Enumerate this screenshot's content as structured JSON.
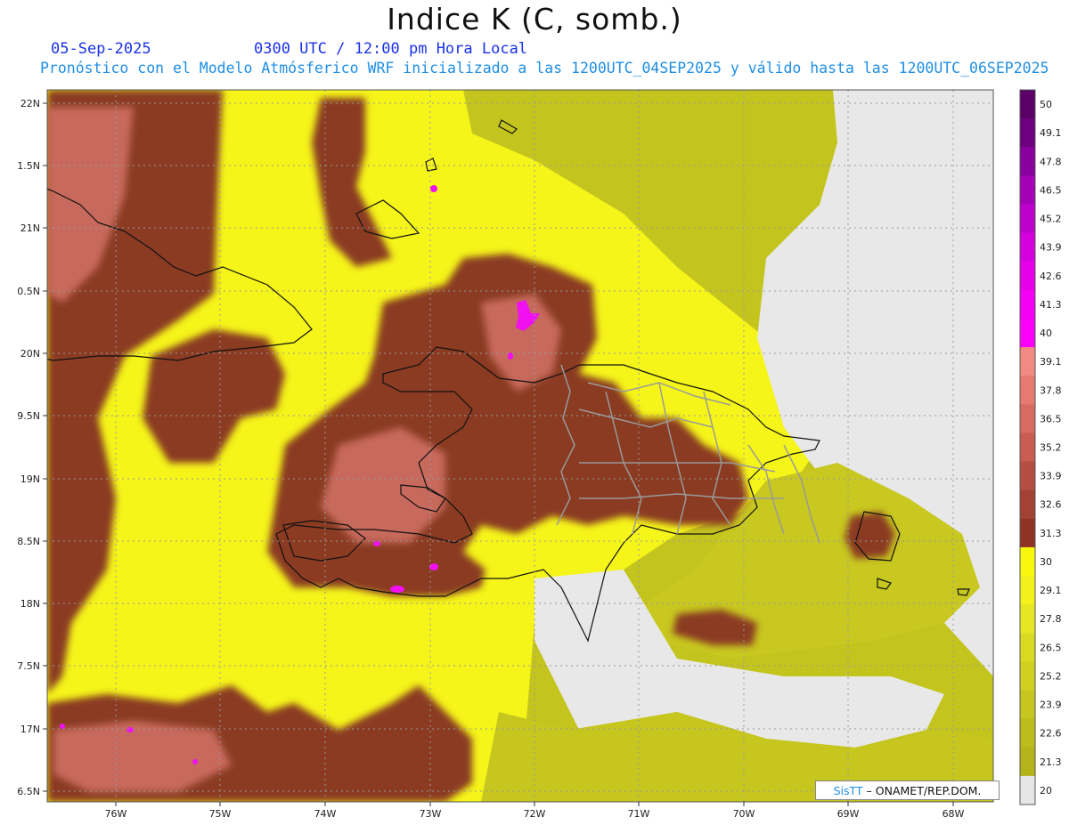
{
  "header": {
    "title": "Indice K (C, somb.)",
    "date": "05-Sep-2025",
    "time": "0300 UTC / 12:00 pm Hora Local",
    "run_info": "Pronóstico con el Modelo Atmósferico WRF inicializado a las 1200UTC_04SEP2025 y válido hasta las  1200UTC_06SEP2025"
  },
  "map": {
    "lon_ticks": [
      "76W",
      "75W",
      "74W",
      "73W",
      "72W",
      "71W",
      "70W",
      "69W",
      "68W"
    ],
    "lat_ticks": [
      "22N",
      "1.5N",
      "21N",
      "0.5N",
      "20N",
      "9.5N",
      "19N",
      "8.5N",
      "18N",
      "7.5N",
      "17N",
      "6.5N"
    ],
    "field_colors": {
      "low_gray": "#e6e6e6",
      "olive": "#c2c21e",
      "yellow": "#f5f51a",
      "brown": "#8a3a22",
      "rose": "#c7695b",
      "magenta": "#f010f0"
    }
  },
  "colorbar": {
    "labels": [
      "50",
      "49.1",
      "47.8",
      "46.5",
      "45.2",
      "43.9",
      "42.6",
      "41.3",
      "40",
      "39.1",
      "37.8",
      "36.5",
      "35.2",
      "33.9",
      "32.6",
      "31.3",
      "30",
      "29.1",
      "27.8",
      "26.5",
      "25.2",
      "23.9",
      "22.6",
      "21.3",
      "20"
    ],
    "colors": [
      "#5a0066",
      "#6e0080",
      "#8a009e",
      "#a400b8",
      "#be00cc",
      "#d400de",
      "#e600ea",
      "#f400f4",
      "#fa00fa",
      "#f28a84",
      "#e67a72",
      "#d86a62",
      "#c95d52",
      "#b54e42",
      "#a34134",
      "#8f3424",
      "#f8f80e",
      "#f2f21a",
      "#e6e622",
      "#dada22",
      "#d0d020",
      "#c6c61e",
      "#bcbc1c",
      "#b4b41a",
      "#e6e6e6"
    ]
  },
  "credit": {
    "logo": "SisTT",
    "text": "– ONAMET/REP.DOM."
  }
}
